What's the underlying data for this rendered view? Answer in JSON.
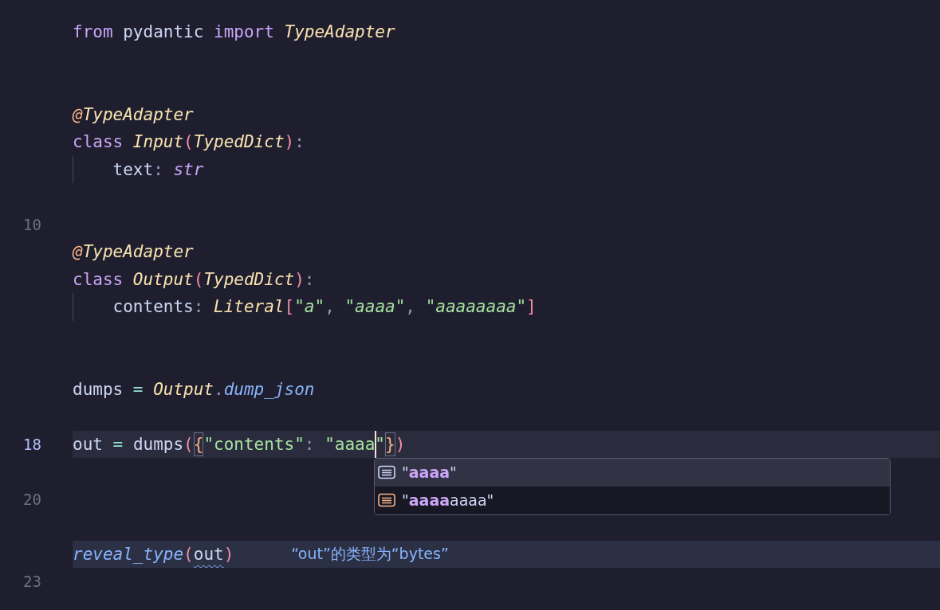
{
  "editor": {
    "lines": [
      {
        "tokens": [
          {
            "text": "from",
            "kind": "keyword"
          },
          {
            "text": " pydantic ",
            "kind": "plain"
          },
          {
            "text": "import",
            "kind": "keyword"
          },
          {
            "text": " TypeAdapter",
            "kind": "class"
          }
        ]
      },
      {
        "kind": "blank"
      },
      {
        "kind": "blank"
      },
      {
        "tokens": [
          {
            "text": "@",
            "kind": "decorator"
          },
          {
            "text": "TypeAdapter",
            "kind": "class"
          }
        ]
      },
      {
        "tokens": [
          {
            "text": "class ",
            "kind": "keyword"
          },
          {
            "text": "Input",
            "kind": "class"
          },
          {
            "text": "(",
            "kind": "paren"
          },
          {
            "text": "TypedDict",
            "kind": "class"
          },
          {
            "text": ")",
            "kind": "paren"
          },
          {
            "text": ":",
            "kind": "punct"
          }
        ]
      },
      {
        "guide": true,
        "tokens": [
          {
            "text": "text",
            "kind": "plain"
          },
          {
            "text": ": ",
            "kind": "punct"
          },
          {
            "text": "str",
            "kind": "builtin"
          }
        ]
      },
      {
        "kind": "blank"
      },
      {
        "number": "10"
      },
      {
        "tokens": [
          {
            "text": "@",
            "kind": "decorator"
          },
          {
            "text": "TypeAdapter",
            "kind": "class"
          }
        ]
      },
      {
        "tokens": [
          {
            "text": "class ",
            "kind": "keyword"
          },
          {
            "text": "Output",
            "kind": "class"
          },
          {
            "text": "(",
            "kind": "paren"
          },
          {
            "text": "TypedDict",
            "kind": "class"
          },
          {
            "text": ")",
            "kind": "paren"
          },
          {
            "text": ":",
            "kind": "punct"
          }
        ]
      },
      {
        "guide": true,
        "tokens": [
          {
            "text": "contents",
            "kind": "plain"
          },
          {
            "text": ": ",
            "kind": "punct"
          },
          {
            "text": "Literal",
            "kind": "class"
          },
          {
            "text": "[",
            "kind": "paren"
          },
          {
            "text": "\"",
            "kind": "string"
          },
          {
            "text": "a",
            "kind": "string-italic"
          },
          {
            "text": "\"",
            "kind": "string"
          },
          {
            "text": ", ",
            "kind": "punct"
          },
          {
            "text": "\"",
            "kind": "string"
          },
          {
            "text": "aaaa",
            "kind": "string-italic"
          },
          {
            "text": "\"",
            "kind": "string"
          },
          {
            "text": ", ",
            "kind": "punct"
          },
          {
            "text": "\"",
            "kind": "string"
          },
          {
            "text": "aaaaaaaa",
            "kind": "string-italic"
          },
          {
            "text": "\"",
            "kind": "string"
          },
          {
            "text": "]",
            "kind": "paren"
          }
        ]
      },
      {
        "kind": "blank"
      },
      {
        "kind": "blank"
      },
      {
        "tokens": [
          {
            "text": "dumps",
            "kind": "plain"
          },
          {
            "text": " = ",
            "kind": "operator"
          },
          {
            "text": "Output",
            "kind": "class"
          },
          {
            "text": ".",
            "kind": "punct"
          },
          {
            "text": "dump_json",
            "kind": "function"
          }
        ]
      },
      {
        "kind": "blank"
      },
      {
        "number": "18",
        "kind": "current",
        "tokens": [
          {
            "text": "out",
            "kind": "plain"
          },
          {
            "text": " = ",
            "kind": "operator"
          },
          {
            "text": "dumps",
            "kind": "plain"
          },
          {
            "text": "(",
            "kind": "paren"
          },
          {
            "text": "{",
            "kind": "brace-match"
          },
          {
            "text": "\"contents\"",
            "kind": "string"
          },
          {
            "text": ": ",
            "kind": "punct"
          },
          {
            "text": "\"aaaa",
            "kind": "string"
          },
          {
            "text": "\"",
            "kind": "string-caret"
          },
          {
            "text": "}",
            "kind": "brace-match"
          },
          {
            "text": ")",
            "kind": "paren"
          }
        ],
        "completion": {
          "items": [
            {
              "selected": true,
              "segments": [
                {
                  "text": "\"",
                  "match": false
                },
                {
                  "text": "aaaa",
                  "match": true
                },
                {
                  "text": "\"",
                  "match": false
                }
              ]
            },
            {
              "selected": false,
              "segments": [
                {
                  "text": "\"",
                  "match": false
                },
                {
                  "text": "aaaa",
                  "match": true
                },
                {
                  "text": "aaaa\"",
                  "match": false
                }
              ]
            }
          ]
        }
      },
      {
        "kind": "blank"
      },
      {
        "number": "20"
      },
      {
        "kind": "blank"
      },
      {
        "kind": "hint",
        "tokens": [
          {
            "text": "reveal_type",
            "kind": "function"
          },
          {
            "text": "(",
            "kind": "paren"
          },
          {
            "text": "out",
            "kind": "warning"
          },
          {
            "text": ")",
            "kind": "paren"
          }
        ],
        "inlay_hint": "“out”的类型为“bytes”"
      },
      {
        "number": "23"
      }
    ]
  }
}
